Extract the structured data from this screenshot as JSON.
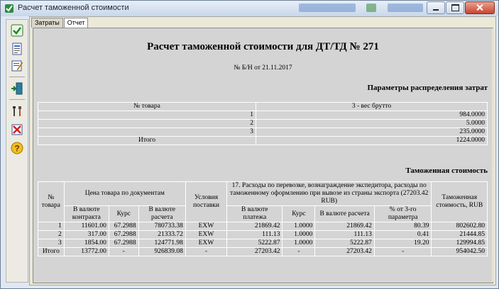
{
  "window": {
    "title": "Расчет таможенной стоимости"
  },
  "tabs": [
    {
      "label": "Затраты"
    },
    {
      "label": "Отчет"
    }
  ],
  "toolbar": {
    "icons": [
      "check-icon",
      "document-icon",
      "edit-icon",
      "exit-icon",
      "tools-icon",
      "delete-icon",
      "help-icon"
    ]
  },
  "report": {
    "title": "Расчет таможенной стоимости для ДТ/ТД № 271",
    "subtitle": "№ Б/Н от 21.11.2017",
    "section1": "Параметры распределения затрат",
    "params": {
      "headers": [
        "№ товара",
        "3 - вес брутто"
      ],
      "rows": [
        {
          "num": "1",
          "val": "984.0000"
        },
        {
          "num": "2",
          "val": "5.0000"
        },
        {
          "num": "3",
          "val": "235.0000"
        }
      ],
      "total_label": "Итого",
      "total_val": "1224.0000"
    },
    "section2": "Таможенная стоимость",
    "customs": {
      "h_num": "№ товара",
      "h_price": "Цена товара по документам",
      "h_terms": "Условия поставки",
      "h_expenses": "17. Расходы по перевозке, вознаграждение экспедитора, расходы по таможенному оформлению при вывозе из страны экспорта (27203.42 RUB)",
      "h_value": "Таможенная стоимость, RUB",
      "sub": {
        "contract_cur": "В валюте контракта",
        "rate": "Курс",
        "calc_cur": "В валюте расчета",
        "pay_cur": "В валюте платежа",
        "rate2": "Курс",
        "calc_cur2": "В валюте расчета",
        "pct": "% от 3-го параметра"
      },
      "rows": [
        {
          "num": "1",
          "contract": "11601.00",
          "rate": "67.2988",
          "calc": "780733.38",
          "terms": "EXW",
          "pay": "21869.42",
          "rate2": "1.0000",
          "calc2": "21869.42",
          "pct": "80.39",
          "value": "802602.80"
        },
        {
          "num": "2",
          "contract": "317.00",
          "rate": "67.2988",
          "calc": "21333.72",
          "terms": "EXW",
          "pay": "111.13",
          "rate2": "1.0000",
          "calc2": "111.13",
          "pct": "0.41",
          "value": "21444.85"
        },
        {
          "num": "3",
          "contract": "1854.00",
          "rate": "67.2988",
          "calc": "124771.98",
          "terms": "EXW",
          "pay": "5222.87",
          "rate2": "1.0000",
          "calc2": "5222.87",
          "pct": "19.20",
          "value": "129994.85"
        }
      ],
      "total": {
        "num": "Итого",
        "contract": "13772.00",
        "rate": "-",
        "calc": "926839.08",
        "terms": "-",
        "pay": "27203.42",
        "rate2": "-",
        "calc2": "27203.42",
        "pct": "-",
        "value": "954042.50"
      }
    }
  },
  "colors": {
    "report_bg": "#d4d4d4",
    "panel_bg": "#ece9d8",
    "titlebar": "#c9d8ea",
    "close_button": "#c9442c"
  }
}
